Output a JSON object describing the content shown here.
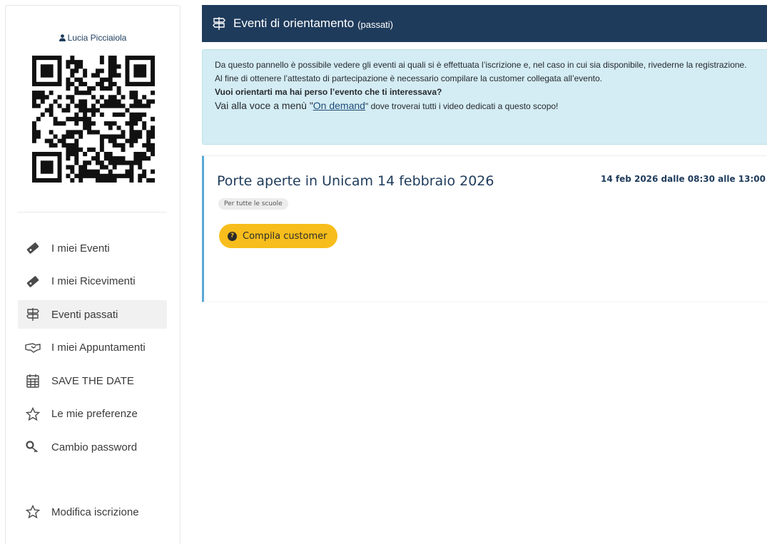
{
  "user": {
    "name": "Lucia Picciaiola",
    "icon": "user-icon"
  },
  "sidebar": {
    "items": [
      {
        "label": "I miei Eventi",
        "icon": "ticket-icon",
        "active": false
      },
      {
        "label": "I miei Ricevimenti",
        "icon": "ticket-icon",
        "active": false
      },
      {
        "label": "Eventi passati",
        "icon": "signpost-icon",
        "active": true
      },
      {
        "label": "I miei Appuntamenti",
        "icon": "handshake-icon",
        "active": false
      },
      {
        "label": "SAVE THE DATE",
        "icon": "calendar-icon",
        "active": false
      },
      {
        "label": "Le mie preferenze",
        "icon": "star-icon",
        "active": false
      },
      {
        "label": "Cambio password",
        "icon": "key-icon",
        "active": false
      }
    ],
    "extra": {
      "label": "Modifica iscrizione",
      "icon": "star-icon"
    }
  },
  "header": {
    "title": "Eventi di orientamento",
    "subtitle": "(passati)",
    "icon": "signpost-icon",
    "bg_color": "#1e3b5b"
  },
  "info": {
    "line1": "Da questo pannello è possibile vedere gli eventi ai quali si è effettuata l’iscrizione e, nel caso in cui sia disponibile, rivederne la registrazione.",
    "line2": "Al fine di ottenere l’attestato di partecipazione è necessario compilare la customer collegata all’evento.",
    "line3": "Vuoi orientarti ma hai perso l’evento che ti interessava?",
    "line4_prefix": "Vai alla voce a menù \"",
    "line4_link": "On demand",
    "line4_suffix": "\" dove troverai tutti i video dedicati a questo scopo!",
    "bg_color": "#d4ecf3"
  },
  "event": {
    "title": "Porte aperte in Unicam 14 febbraio 2026",
    "date": "14 feb 2026 dalle 08:30 alle 13:00",
    "badge": "Per tutte le scuole",
    "button_label": "Compila customer",
    "button_icon": "question-circle-icon",
    "button_color": "#f7bd1c"
  }
}
